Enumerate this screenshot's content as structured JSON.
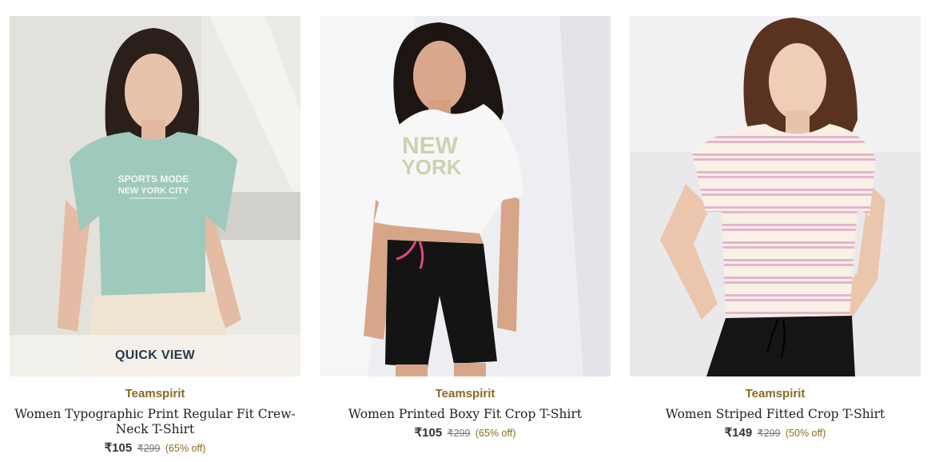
{
  "products": [
    {
      "brand": "Teamspirit",
      "title": "Women Typographic Print Regular Fit Crew-Neck T-Shirt",
      "price": "₹105",
      "mrp": "₹299",
      "discount": "(65% off)",
      "quick_view": "QUICK VIEW",
      "print_line1": "SPORTS MODE",
      "print_line2": "NEW YORK CITY",
      "colors": {
        "tee": "#9fc9bd",
        "bottom": "#efe4cf",
        "bg": "#e4e2dc"
      }
    },
    {
      "brand": "Teamspirit",
      "title": "Women Printed Boxy Fit Crop T-Shirt",
      "price": "₹105",
      "mrp": "₹299",
      "discount": "(65% off)",
      "print_line1": "NEW",
      "print_line2": "YORK",
      "colors": {
        "tee": "#f6f6f6",
        "bottom": "#141414",
        "bg": "#eceef2"
      }
    },
    {
      "brand": "Teamspirit",
      "title": "Women Striped Fitted Crop T-Shirt",
      "price": "₹149",
      "mrp": "₹299",
      "discount": "(50% off)",
      "colors": {
        "tee": "#f8f1e6",
        "stripe": "#e7b3cf",
        "bottom": "#151515",
        "bg": "#e9e9ec"
      }
    }
  ],
  "theme": {
    "brand_color": "#8a6a22",
    "quick_view_text": "#253a4d"
  }
}
